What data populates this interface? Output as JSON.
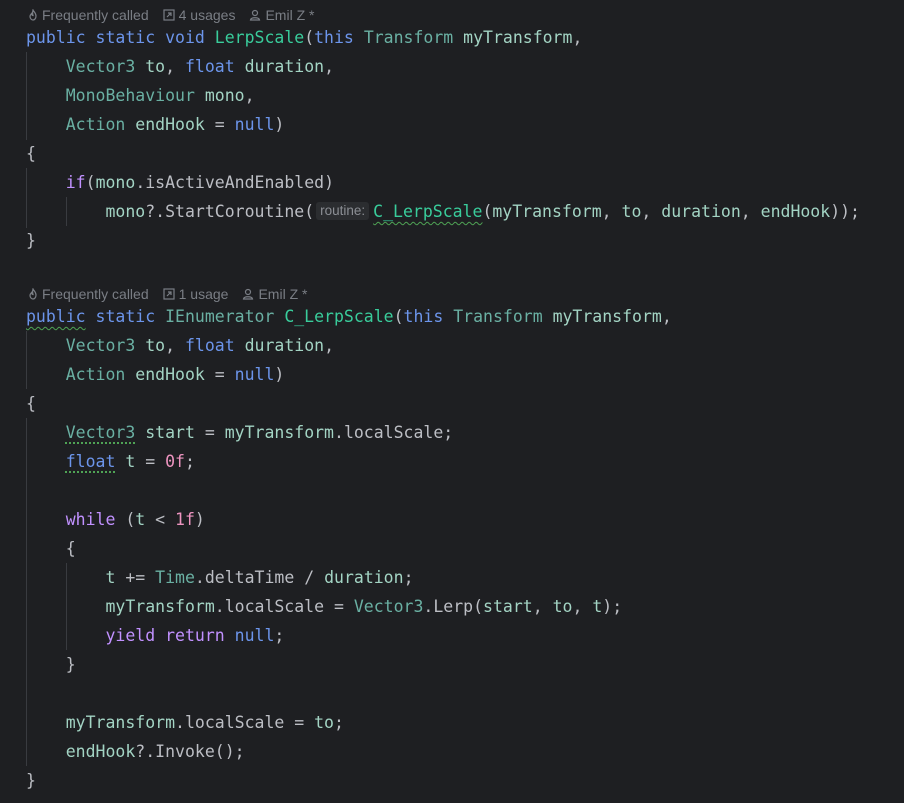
{
  "hints": [
    {
      "frequent": "Frequently called",
      "usages": "4 usages",
      "author": "Emil Z *"
    },
    {
      "frequent": "Frequently called",
      "usages": "1 usage",
      "author": "Emil Z *"
    }
  ],
  "param_hint": "routine:",
  "colors": {
    "background": "#1e1f22",
    "keyword": "#cf8e6d",
    "type": "#66c3cc",
    "method": "#39cc9b",
    "text": "#bcbec4",
    "hint": "#7a7e85"
  },
  "icons": [
    "flame-icon",
    "usages-link-icon",
    "person-icon"
  ]
}
